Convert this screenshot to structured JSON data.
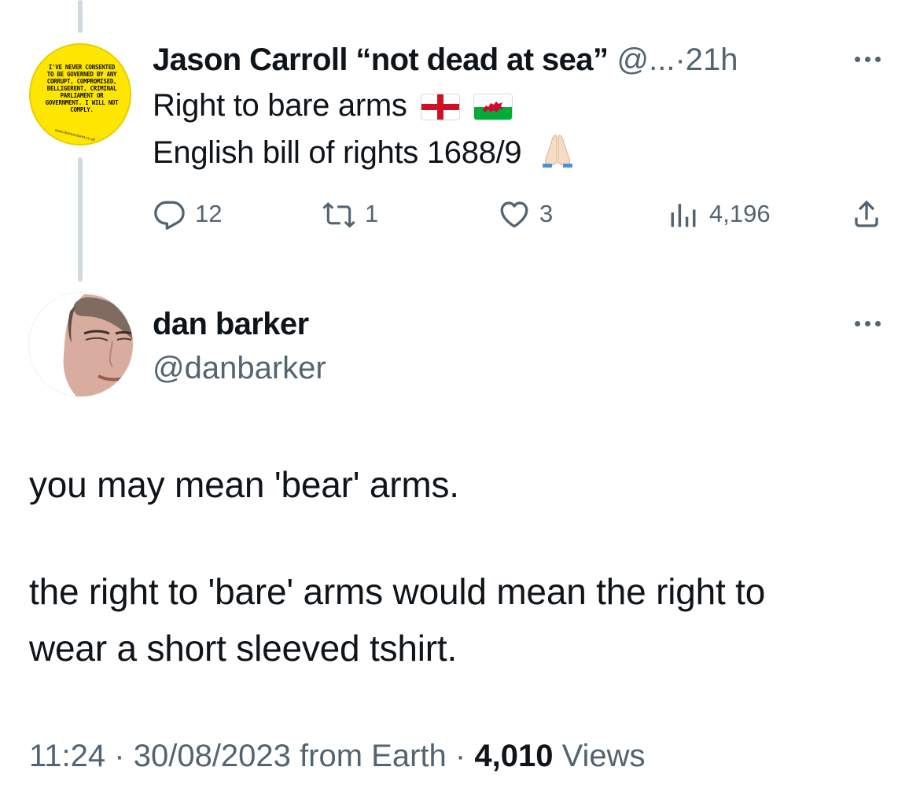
{
  "parent_tweet": {
    "avatar_text": "I'VE NEVER CONSENTED TO BE GOVERNED BY ANY CORRUPT, COMPROMISED, BELLIGERENT, CRIMINAL PARLIAMENT OR GOVERNMENT. I WILL NOT COMPLY.",
    "avatar_url": "www.dontconsent.co.uk",
    "author_name": "Jason Carroll “not dead at sea”",
    "author_handle": "@...",
    "separator": "·",
    "time": "21h",
    "line1": "Right to bare arms",
    "line2": "English bill of rights 1688/9",
    "emoji": [
      "flag-england",
      "flag-wales",
      "folded-hands"
    ],
    "stats": {
      "replies": "12",
      "retweets": "1",
      "likes": "3",
      "views": "4,196"
    }
  },
  "reply_tweet": {
    "author_name": "dan barker",
    "author_handle": "@danbarker",
    "body_line1": "you may mean 'bear' arms.",
    "body_line2": "the right to 'bare' arms would mean the right to",
    "body_line3": "wear a short sleeved tshirt.",
    "time": "11:24",
    "separator": "·",
    "date": "30/08/2023",
    "source": "from Earth",
    "views_count": "4,010",
    "views_label": "Views"
  },
  "colors": {
    "text": "#0f1419",
    "muted": "#536471",
    "thread_line": "#cfd9de",
    "avatar_yellow": "#ffe600"
  }
}
